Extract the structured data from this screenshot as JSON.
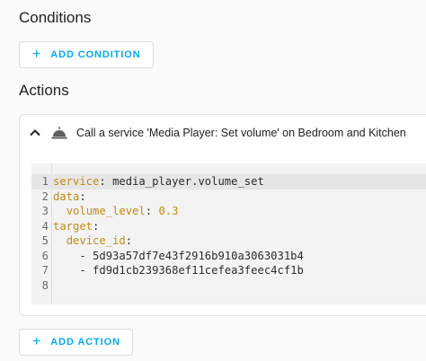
{
  "conditions": {
    "title": "Conditions",
    "add_button": {
      "icon": "plus-icon",
      "plus": "+",
      "label": "ADD CONDITION"
    }
  },
  "actions": {
    "title": "Actions",
    "card": {
      "collapse_icon": "chevron-up-icon",
      "service_icon": "room-service-icon",
      "title": "Call a service 'Media Player: Set volume' on Bedroom and Kitchen"
    },
    "code_lines": [
      {
        "num": "1",
        "indent": "",
        "key": "service",
        "sep": ": ",
        "value": "media_player.volume_set"
      },
      {
        "num": "2",
        "indent": "",
        "key": "data",
        "sep": ":",
        "value": ""
      },
      {
        "num": "3",
        "indent": "  ",
        "key": "volume_level",
        "sep": ": ",
        "value": "0.3"
      },
      {
        "num": "4",
        "indent": "",
        "key": "target",
        "sep": ":",
        "value": ""
      },
      {
        "num": "5",
        "indent": "  ",
        "key": "device_id",
        "sep": ":",
        "value": ""
      },
      {
        "num": "6",
        "indent": "    ",
        "key": "",
        "sep": "- ",
        "value": "5d93a57df7e43f2916b910a3063031b4"
      },
      {
        "num": "7",
        "indent": "    ",
        "key": "",
        "sep": "- ",
        "value": "fd9d1cb239368ef11cefea3feec4cf1b"
      },
      {
        "num": "8",
        "indent": "",
        "key": "",
        "sep": "",
        "value": ""
      }
    ],
    "add_button": {
      "icon": "plus-icon",
      "plus": "+",
      "label": "ADD ACTION"
    }
  },
  "colors": {
    "accent": "#03a9f4",
    "yaml_key": "#c48a12"
  }
}
